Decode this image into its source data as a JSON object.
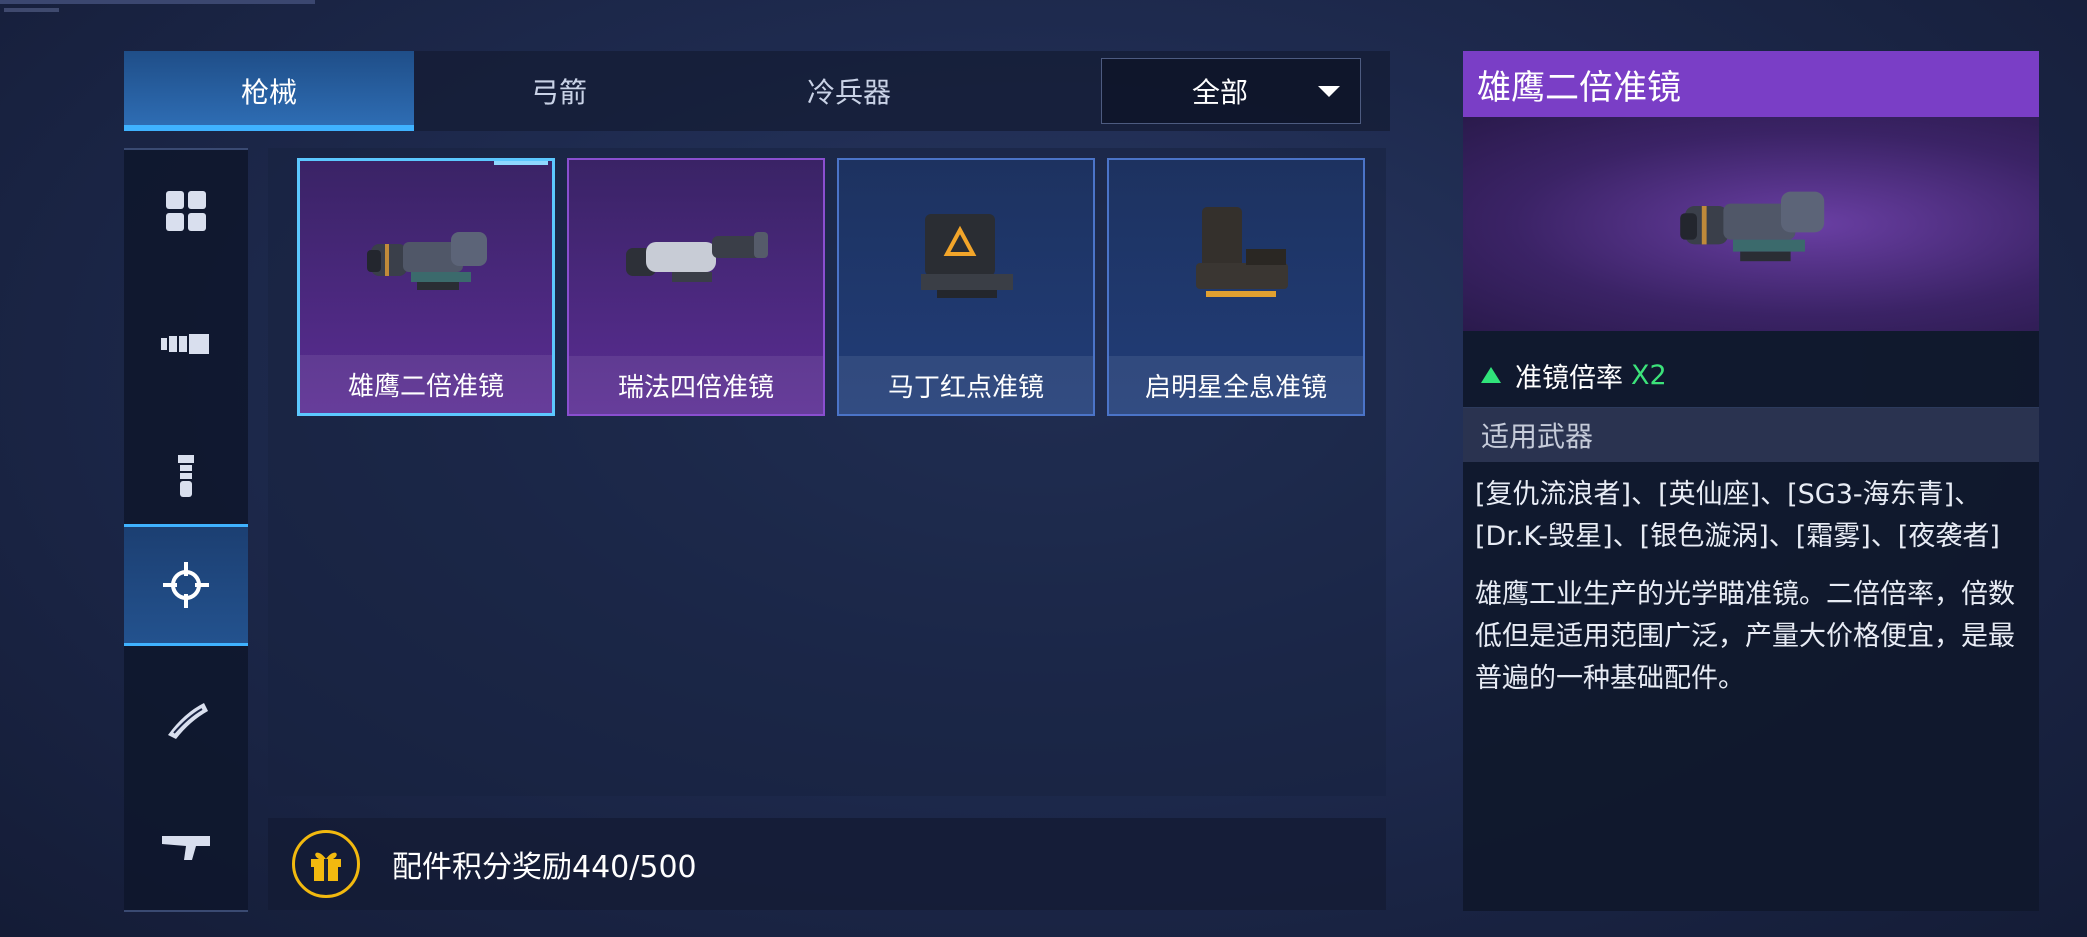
{
  "tabs": [
    {
      "label": "枪械",
      "active": true
    },
    {
      "label": "弓箭",
      "active": false
    },
    {
      "label": "冷兵器",
      "active": false
    }
  ],
  "filter": {
    "selected": "全部"
  },
  "sidebar": [
    {
      "icon": "grid-icon",
      "active": false
    },
    {
      "icon": "barrel-icon",
      "active": false
    },
    {
      "icon": "grip-icon",
      "active": false
    },
    {
      "icon": "crosshair-icon",
      "active": true
    },
    {
      "icon": "magazine-icon",
      "active": false
    },
    {
      "icon": "stock-icon",
      "active": false
    }
  ],
  "items": [
    {
      "name": "雄鹰二倍准镜",
      "rarity": "purple",
      "selected": true
    },
    {
      "name": "瑞法四倍准镜",
      "rarity": "purple",
      "selected": false
    },
    {
      "name": "马丁红点准镜",
      "rarity": "blue",
      "selected": false
    },
    {
      "name": "启明星全息准镜",
      "rarity": "blue",
      "selected": false
    }
  ],
  "reward": {
    "text": "配件积分奖励440/500",
    "current": 440,
    "max": 500
  },
  "detail": {
    "title": "雄鹰二倍准镜",
    "stat_label": "准镜倍率",
    "stat_value": "X2",
    "section_title": "适用武器",
    "weapons": "[复仇流浪者]、[英仙座]、[SG3-海东青]、[Dr.K-毁星]、[银色漩涡]、[霜雾]、[夜袭者]",
    "description": "雄鹰工业生产的光学瞄准镜。二倍倍率，倍数低但是适用范围广泛，产量大价格便宜，是最普遍的一种基础配件。"
  },
  "colors": {
    "purple": "#7a3ec6",
    "blue": "#2f6fb7",
    "accent": "#3fb2ff",
    "gold": "#f2b90f",
    "green": "#3ce27a"
  }
}
